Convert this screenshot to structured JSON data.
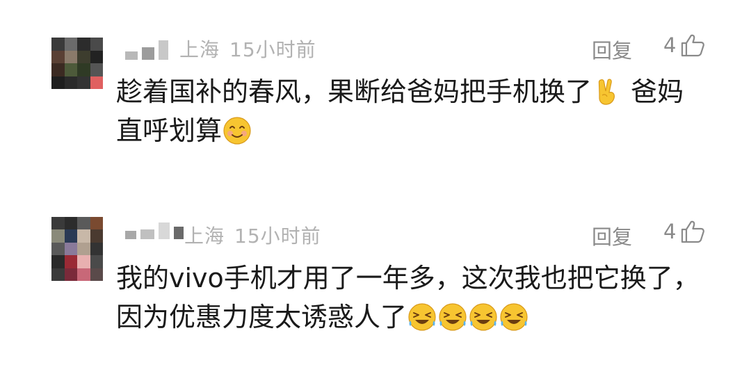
{
  "comments": [
    {
      "location": "上海",
      "time": "15小时前",
      "reply_label": "回复",
      "like_count": "4",
      "text_before": "趁着国补的春风，果断给爸妈把手机换了",
      "text_after": "爸妈直呼划算",
      "emojis": [
        "victory-hand-emoji",
        "smiling-face-emoji"
      ]
    },
    {
      "location": "上海",
      "time": "15小时前",
      "reply_label": "回复",
      "like_count": "4",
      "text": "我的vivo手机才用了一年多，这次我也把它换了，因为优惠力度太诱惑人了",
      "emojis": [
        "laughing-crying-emoji",
        "laughing-crying-emoji",
        "laughing-crying-emoji",
        "laughing-crying-emoji"
      ]
    }
  ],
  "colors": {
    "meta": "#b2b2b2",
    "action": "#8a8a8a",
    "body": "#1a1a1a",
    "emoji_yellow": "#f7c531"
  }
}
